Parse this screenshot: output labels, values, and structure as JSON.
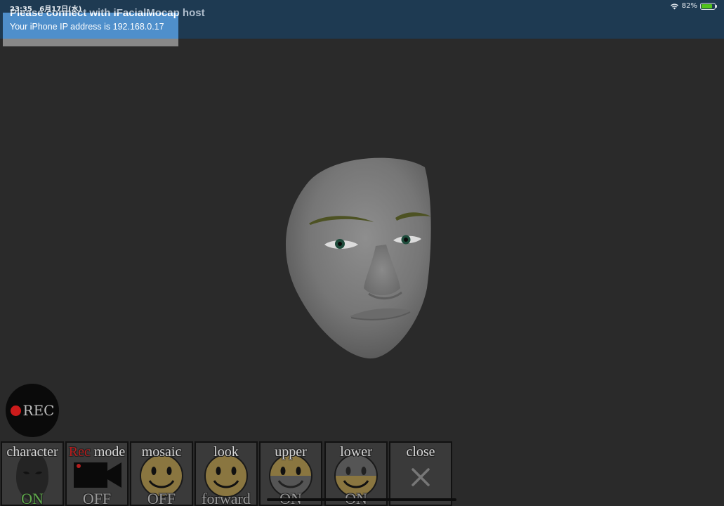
{
  "status_bar": {
    "time": "23:35",
    "date": "6月17日(水)",
    "battery": "82%",
    "battery_level": 0.82,
    "wifi_icon": "wifi-icon"
  },
  "header": {
    "connect_title": "Please connect with iFacialMocap host"
  },
  "popup": {
    "title": "Please connect with iFacialMocap",
    "ip_text": "Your iPhone IP address is 192.168.0.17"
  },
  "rec": {
    "label": "REC",
    "dot_color": "#cc1b1b"
  },
  "toolbar": [
    {
      "name": "character",
      "label": "character",
      "status": "ON"
    },
    {
      "name": "rec-mode",
      "label_accent": "Rec",
      "label_rest": " mode",
      "status": "OFF"
    },
    {
      "name": "mosaic",
      "label": "mosaic",
      "status": "OFF"
    },
    {
      "name": "look",
      "label": "look",
      "status": "forward"
    },
    {
      "name": "upper",
      "label": "upper",
      "status": "ON"
    },
    {
      "name": "lower",
      "label": "lower",
      "status": "ON"
    },
    {
      "name": "close",
      "label": "close",
      "status": ""
    }
  ],
  "colors": {
    "topbar": "#1e3a52",
    "popup": "#4f8fcb",
    "background": "#2a2a2a",
    "rec_accent": "#b41e1e",
    "status_on": "#5ea84a"
  }
}
